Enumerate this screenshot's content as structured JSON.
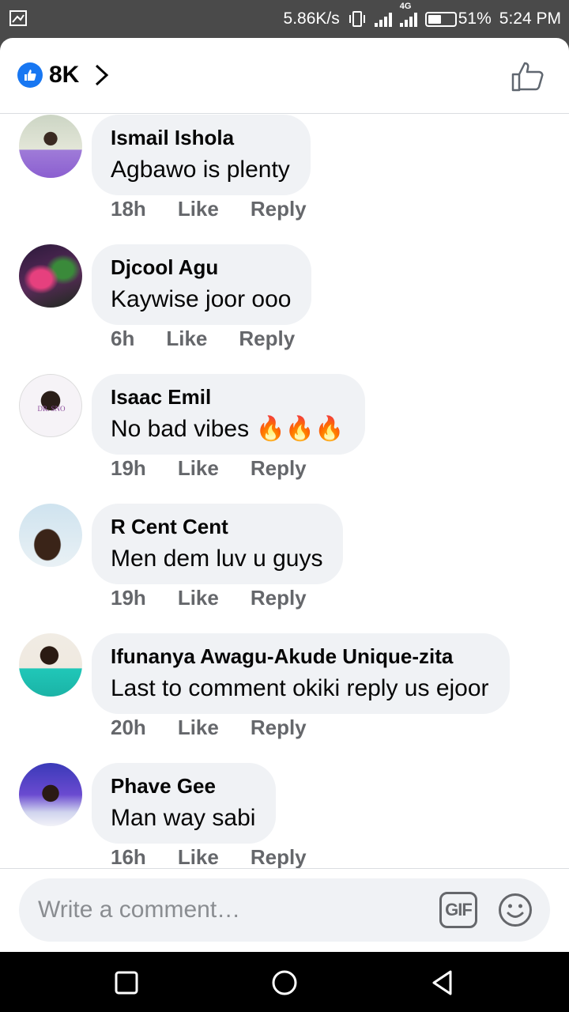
{
  "status_bar": {
    "net_speed": "5.86K/s",
    "network_type": "4G",
    "battery": "51%",
    "battery_level": 0.51,
    "time": "5:24 PM"
  },
  "header": {
    "reaction_count": "8K",
    "reaction_icon": "like-icon",
    "accent_color": "#1877f2"
  },
  "comments": [
    {
      "name": "Ismail Ishola",
      "text": "Agbawo is plenty",
      "time": "18h",
      "like": "Like",
      "reply": "Reply"
    },
    {
      "name": "Djcool Agu",
      "text": "Kaywise joor ooo",
      "time": "6h",
      "like": "Like",
      "reply": "Reply"
    },
    {
      "name": "Isaac Emil",
      "text": "No bad vibes 🔥🔥🔥",
      "time": "19h",
      "like": "Like",
      "reply": "Reply",
      "avatar_text": "DR. SNO"
    },
    {
      "name": "R Cent Cent",
      "text": "Men dem luv u guys",
      "time": "19h",
      "like": "Like",
      "reply": "Reply"
    },
    {
      "name": "Ifunanya Awagu-Akude Unique-zita",
      "text": "Last to comment okiki reply us ejoor",
      "time": "20h",
      "like": "Like",
      "reply": "Reply"
    },
    {
      "name": "Phave Gee",
      "text": "Man way sabi",
      "time": "16h",
      "like": "Like",
      "reply": "Reply"
    }
  ],
  "comment_input": {
    "placeholder": "Write a comment…",
    "gif_label": "GIF"
  },
  "nav": {
    "recents_icon": "square-icon",
    "home_icon": "circle-icon",
    "back_icon": "triangle-back-icon"
  }
}
